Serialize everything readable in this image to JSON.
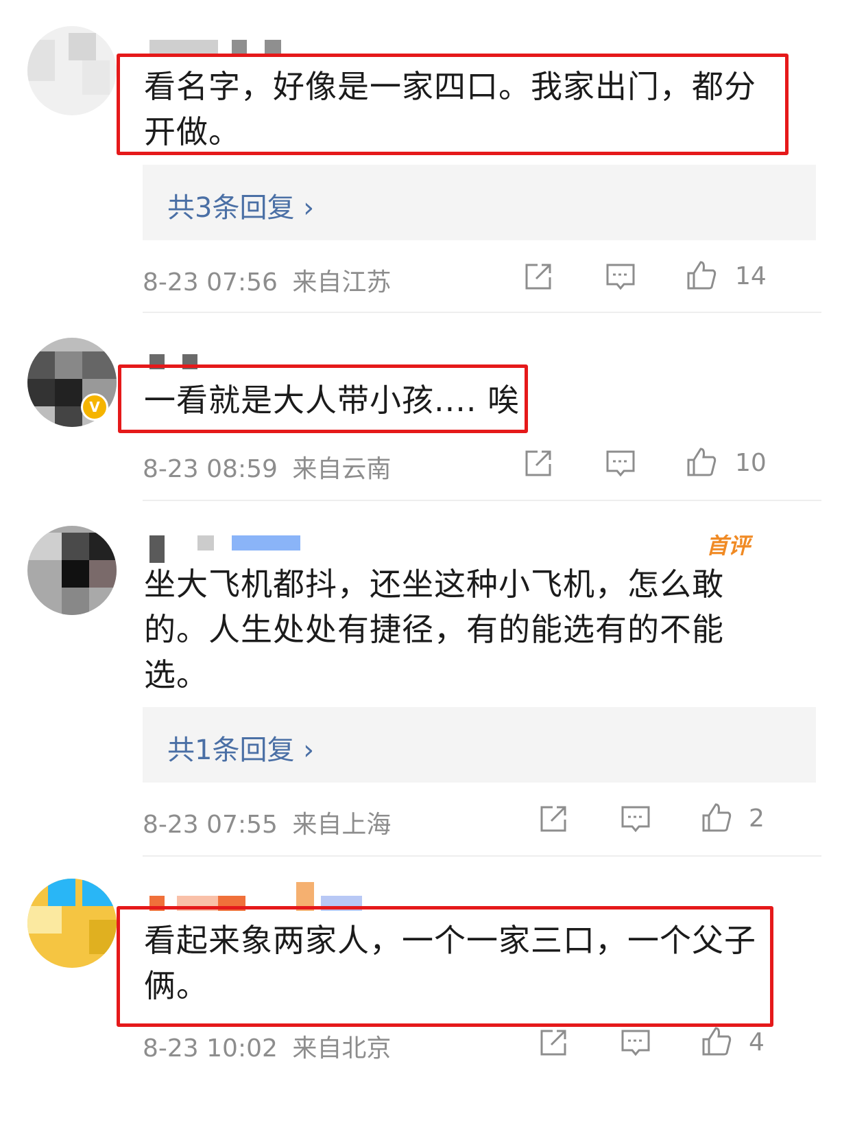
{
  "colors": {
    "highlight": "#e5191a",
    "link": "#4a6fa5",
    "meta": "#8d8d8d",
    "badge_first": "#f08a24",
    "verified": "#f5b400"
  },
  "comments": [
    {
      "text": "看名字，好像是一家四口。我家出门，都分开做。",
      "text_lines": [
        "看名字，好像是一家四口。我家出门，都分",
        "开做。"
      ],
      "replies_label": "共3条回复",
      "timestamp": "8-23 07:56",
      "location": "来自江苏",
      "likes": "14"
    },
    {
      "text": "一看就是大人带小孩.... 唉",
      "text_lines": [
        "一看就是大人带小孩.... 唉"
      ],
      "verified_badge": "V",
      "timestamp": "8-23 08:59",
      "location": "来自云南",
      "likes": "10"
    },
    {
      "text": "坐大飞机都抖，还坐这种小飞机，怎么敢的。人生处处有捷径，有的能选有的不能选。",
      "text_lines": [
        "坐大飞机都抖，还坐这种小飞机，怎么敢",
        "的。人生处处有捷径，有的能选有的不能",
        "选。"
      ],
      "badge": "首评",
      "replies_label": "共1条回复",
      "timestamp": "8-23 07:55",
      "location": "来自上海",
      "likes": "2"
    },
    {
      "text": "看起来象两家人，一个一家三口，一个父子俩。",
      "text_lines": [
        "看起来象两家人，一个一家三口，一个父子",
        "俩。"
      ],
      "timestamp": "8-23 10:02",
      "location": "来自北京",
      "likes": "4"
    }
  ],
  "icons": {
    "share": "share-icon",
    "comment": "comment-icon",
    "like": "thumbs-up-icon",
    "more": "chevron-right-icon"
  }
}
